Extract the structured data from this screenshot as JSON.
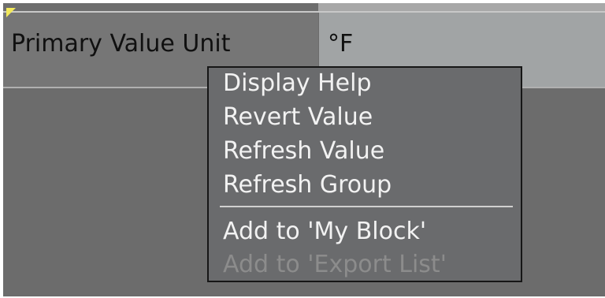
{
  "parameter_row": {
    "label": "Primary Value Unit",
    "value": "°F",
    "flag_color": "#f3e95a"
  },
  "context_menu": {
    "items": [
      {
        "label": "Display Help",
        "enabled": true
      },
      {
        "label": "Revert Value",
        "enabled": true
      },
      {
        "label": "Refresh Value",
        "enabled": true
      },
      {
        "label": "Refresh Group",
        "enabled": true
      },
      {
        "label": "Add to 'My Block'",
        "enabled": true
      },
      {
        "label": "Add to 'Export List'",
        "enabled": false
      }
    ]
  }
}
